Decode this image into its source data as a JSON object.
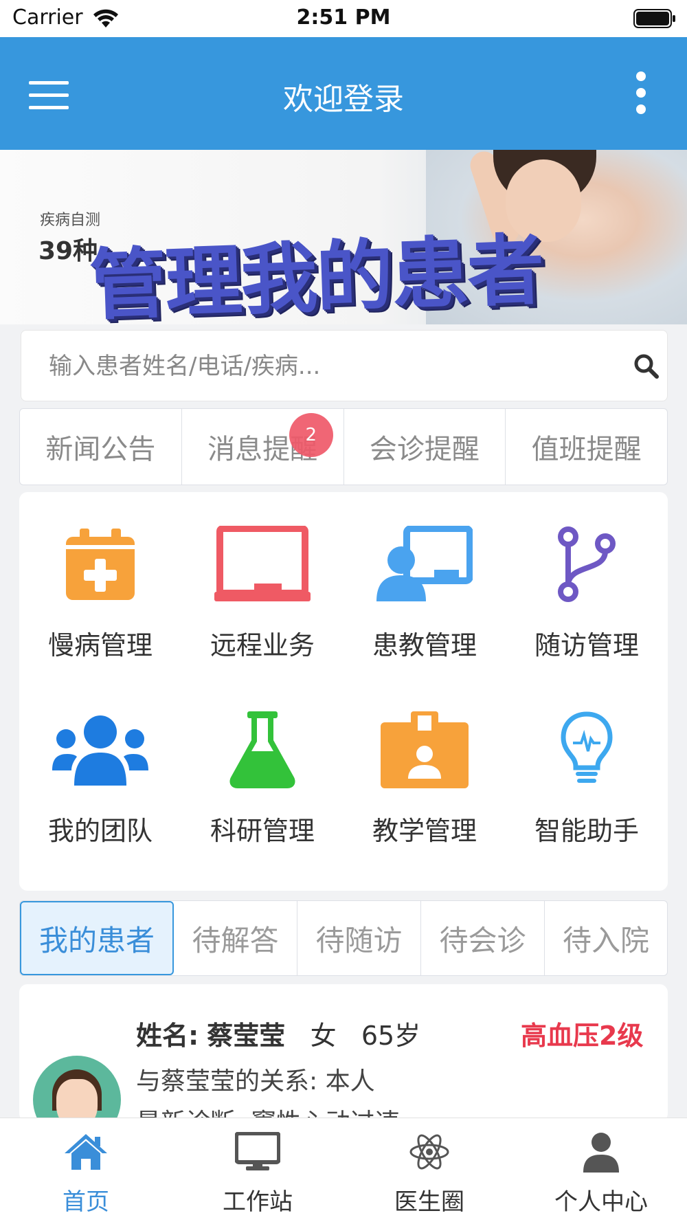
{
  "status_bar": {
    "carrier": "Carrier",
    "time": "2:51 PM"
  },
  "nav": {
    "title": "欢迎登录"
  },
  "banner": {
    "subtitle": "疾病自测",
    "count": "39种",
    "headline": "管理我的患者"
  },
  "search": {
    "placeholder": "输入患者姓名/电话/疾病..."
  },
  "notice_tabs": [
    {
      "label": "新闻公告"
    },
    {
      "label": "消息提醒",
      "badge": "2"
    },
    {
      "label": "会诊提醒"
    },
    {
      "label": "值班提醒"
    }
  ],
  "features": [
    {
      "label": "慢病管理",
      "icon": "calendar-plus-icon",
      "color": "#f7a23b"
    },
    {
      "label": "远程业务",
      "icon": "monitor-icon",
      "color": "#ef5a64"
    },
    {
      "label": "患教管理",
      "icon": "user-screen-icon",
      "color": "#4aa3ef"
    },
    {
      "label": "随访管理",
      "icon": "branch-icon",
      "color": "#6e58c4"
    },
    {
      "label": "我的团队",
      "icon": "team-icon",
      "color": "#1e7ce0"
    },
    {
      "label": "科研管理",
      "icon": "flask-icon",
      "color": "#33c23a"
    },
    {
      "label": "教学管理",
      "icon": "badge-icon",
      "color": "#f7a23b"
    },
    {
      "label": "智能助手",
      "icon": "lightbulb-icon",
      "color": "#3da8ef"
    }
  ],
  "patient_tabs": [
    {
      "label": "我的患者",
      "active": true
    },
    {
      "label": "待解答"
    },
    {
      "label": "待随访"
    },
    {
      "label": "待会诊"
    },
    {
      "label": "待入院"
    }
  ],
  "patient": {
    "name_label": "姓名:",
    "name": "蔡莹莹",
    "gender": "女",
    "age": "65岁",
    "tag": "高血压2级",
    "relation_label": "与蔡莹莹的关系:",
    "relation": "本人",
    "diagnosis_label": "最新诊断:",
    "diagnosis": "窦性心动过速"
  },
  "tab_bar": [
    {
      "label": "首页",
      "icon": "home-icon",
      "active": true
    },
    {
      "label": "工作站",
      "icon": "desktop-icon"
    },
    {
      "label": "医生圈",
      "icon": "atom-icon"
    },
    {
      "label": "个人中心",
      "icon": "person-icon"
    }
  ],
  "colors": {
    "primary": "#3797dd",
    "badge": "#ef5a6a",
    "danger": "#e8394d",
    "active_tab_bg": "#e5f2fd"
  }
}
